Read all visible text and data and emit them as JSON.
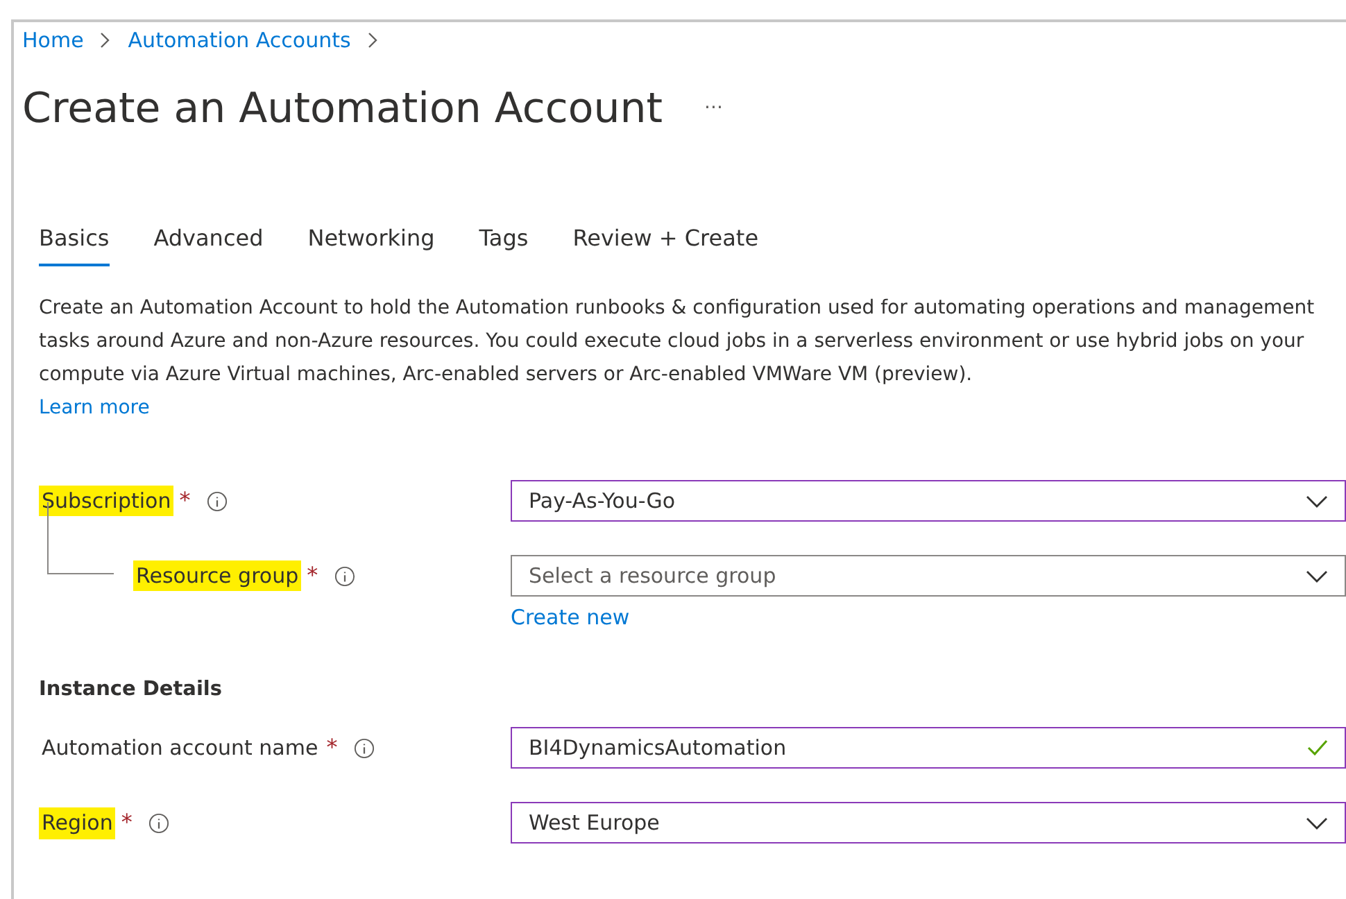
{
  "breadcrumb": [
    "Home",
    "Automation Accounts"
  ],
  "title": "Create an Automation Account",
  "more": "···",
  "tabs": [
    {
      "label": "Basics",
      "selected": true
    },
    {
      "label": "Advanced",
      "selected": false
    },
    {
      "label": "Networking",
      "selected": false
    },
    {
      "label": "Tags",
      "selected": false
    },
    {
      "label": "Review + Create",
      "selected": false
    }
  ],
  "description": "Create an Automation Account to hold the Automation runbooks & configuration used for automating operations and management tasks around Azure and non-Azure resources. You could execute cloud jobs in a serverless environment or use hybrid jobs on your compute via Azure Virtual machines, Arc-enabled servers or Arc-enabled VMWare VM (preview).",
  "learn_more": "Learn more",
  "project_fields": [
    {
      "label": "Subscription",
      "required": "*",
      "highlighted": true,
      "kind": "dropdown",
      "value": "Pay-As-You-Go",
      "valid": true,
      "children": [
        {
          "label": "Resource group",
          "required": "*",
          "highlighted": true,
          "kind": "dropdown",
          "placeholder": "Select a resource group",
          "valid": false,
          "link": "Create new"
        }
      ]
    }
  ],
  "instance_heading": "Instance Details",
  "instance_fields": [
    {
      "label": "Automation account name",
      "required": "*",
      "highlighted": false,
      "kind": "text",
      "value": "BI4DynamicsAutomation",
      "valid": true
    },
    {
      "label": "Region",
      "required": "*",
      "highlighted": true,
      "kind": "dropdown",
      "value": "West Europe",
      "valid": true
    }
  ]
}
